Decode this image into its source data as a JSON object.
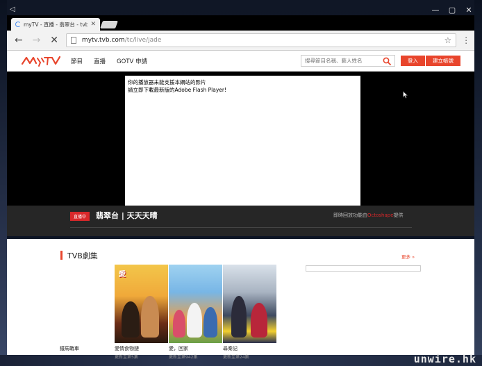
{
  "os": {
    "back_glyph": "◁",
    "controls": [
      "minimize-icon",
      "maximize-icon",
      "close-icon"
    ]
  },
  "browser": {
    "tab": {
      "title": "myTV - 直播 - 翡翠台 - tvb.co",
      "close": "✕"
    },
    "toolbar": {
      "url_host": "mytv.tvb.com",
      "url_path": "/tc/live/jade"
    }
  },
  "site": {
    "nav": [
      "節目",
      "直播",
      "GOTV 申請"
    ],
    "search_placeholder": "搜尋節目名稱、藝人姓名",
    "login": "登入",
    "register": "建立帳號",
    "brand_color": "#e8452c"
  },
  "player": {
    "flash_line1": "你的播放器未能支援本網站的影片",
    "flash_line2": "請立即下載最新版的Adobe Flash Player!"
  },
  "live": {
    "badge": "直播中",
    "title": "翡翠台 | 天天天晴",
    "octo_prefix": "即時回放功能由",
    "octo_brand": "Octoshape",
    "octo_suffix": "提供"
  },
  "section": {
    "title": "TVB劇集",
    "more": "更多 »",
    "items": [
      {
        "title": "鐵馬戰車",
        "sub": ""
      },
      {
        "title": "愛情食物鏈",
        "sub": "更新至第5集"
      },
      {
        "title": "愛，回家",
        "sub": "更新至第942集"
      },
      {
        "title": "尋秦記",
        "sub": "更新至第24集"
      }
    ]
  },
  "watermark": "unwire.hk"
}
